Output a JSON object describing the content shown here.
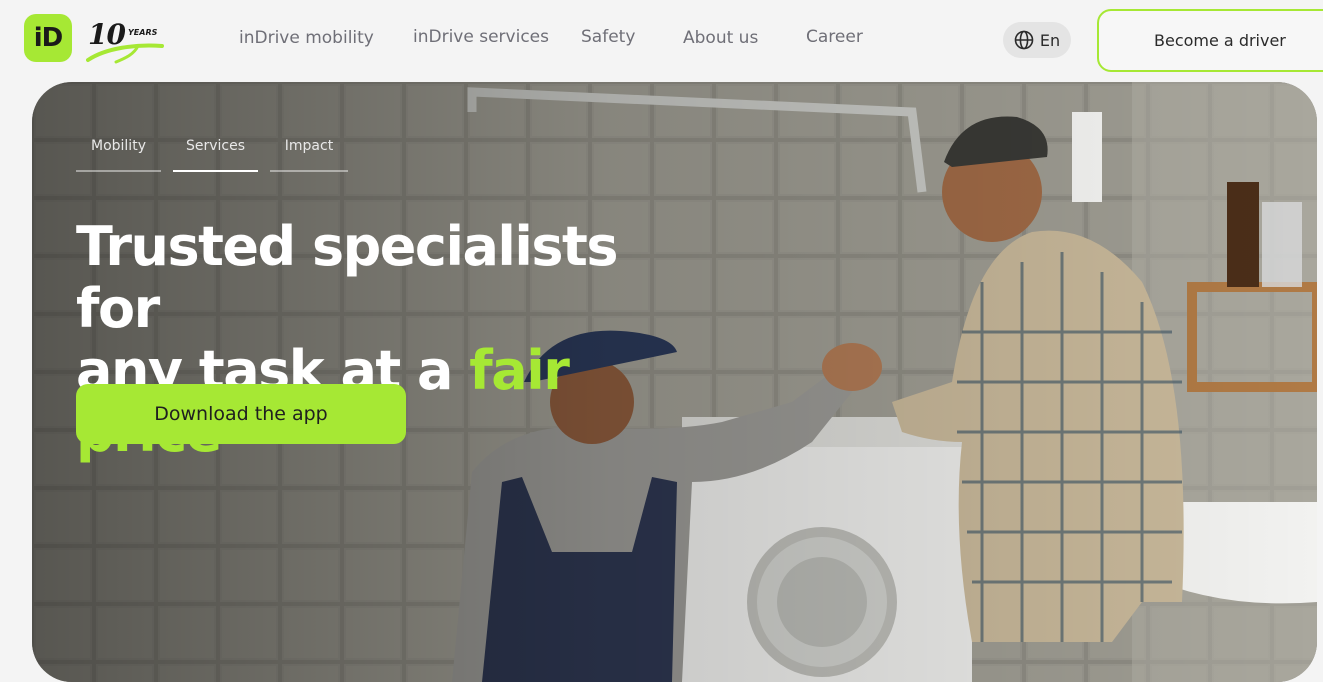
{
  "brand": {
    "logo_text": "iD",
    "years_number": "10",
    "years_label": "YEARS",
    "accent": "#a6e834"
  },
  "nav": {
    "items": [
      {
        "label": "inDrive mobility"
      },
      {
        "label": "inDrive services"
      },
      {
        "label": "Safety"
      },
      {
        "label": "About us"
      },
      {
        "label": "Career"
      }
    ],
    "language": "En",
    "language_icon": "globe-icon",
    "driver_button": "Become a driver"
  },
  "hero": {
    "tabs": [
      {
        "label": "Mobility",
        "active": false
      },
      {
        "label": "Services",
        "active": true
      },
      {
        "label": "Impact",
        "active": false
      }
    ],
    "headline_part1": "Trusted specialists for",
    "headline_part2": "any task at a ",
    "headline_accent": "fair price",
    "download_button": "Download the app",
    "image": "photo-handshake-plumber-washing-machine"
  }
}
